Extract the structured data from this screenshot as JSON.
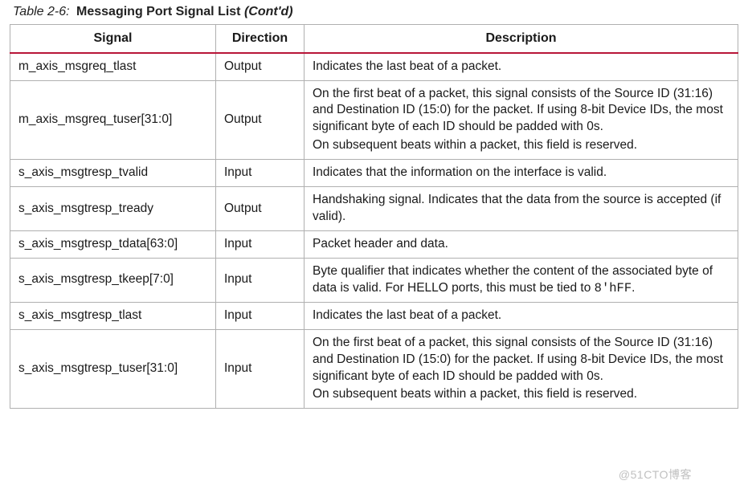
{
  "caption": {
    "label": "Table 2-6:",
    "title": "Messaging Port Signal List",
    "contd": "(Cont'd)"
  },
  "headers": {
    "signal": "Signal",
    "direction": "Direction",
    "description": "Description"
  },
  "rows": [
    {
      "signal": "m_axis_msgreq_tlast",
      "direction": "Output",
      "description": [
        "Indicates the last beat of a packet."
      ]
    },
    {
      "signal": "m_axis_msgreq_tuser[31:0]",
      "direction": "Output",
      "description": [
        "On the first beat of a packet, this signal consists of the Source ID (31:16) and Destination ID (15:0) for the packet. If using 8-bit Device IDs, the most significant byte of each ID should be padded with 0s.",
        "On subsequent beats within a packet, this field is reserved."
      ]
    },
    {
      "signal": "s_axis_msgtresp_tvalid",
      "direction": "Input",
      "description": [
        "Indicates that the information on the interface is valid."
      ]
    },
    {
      "signal": "s_axis_msgtresp_tready",
      "direction": "Output",
      "description": [
        "Handshaking signal. Indicates that the data from the source is accepted (if valid)."
      ]
    },
    {
      "signal": "s_axis_msgtresp_tdata[63:0]",
      "direction": "Input",
      "description": [
        "Packet header and data."
      ]
    },
    {
      "signal": "s_axis_msgtresp_tkeep[7:0]",
      "direction": "Input",
      "description_rich": {
        "prefix": "Byte qualifier that indicates whether the content of the associated byte of data is valid. For HELLO ports, this must be tied to ",
        "code": "8'hFF",
        "suffix": "."
      }
    },
    {
      "signal": "s_axis_msgtresp_tlast",
      "direction": "Input",
      "description": [
        "Indicates the last beat of a packet."
      ]
    },
    {
      "signal": "s_axis_msgtresp_tuser[31:0]",
      "direction": "Input",
      "description": [
        "On the first beat of a packet, this signal consists of the Source ID (31:16) and Destination ID (15:0) for the packet. If using 8-bit Device IDs, the most significant byte of each ID should be padded with 0s.",
        "On subsequent beats within a packet, this field is reserved."
      ]
    }
  ],
  "watermark": "@51CTO博客"
}
